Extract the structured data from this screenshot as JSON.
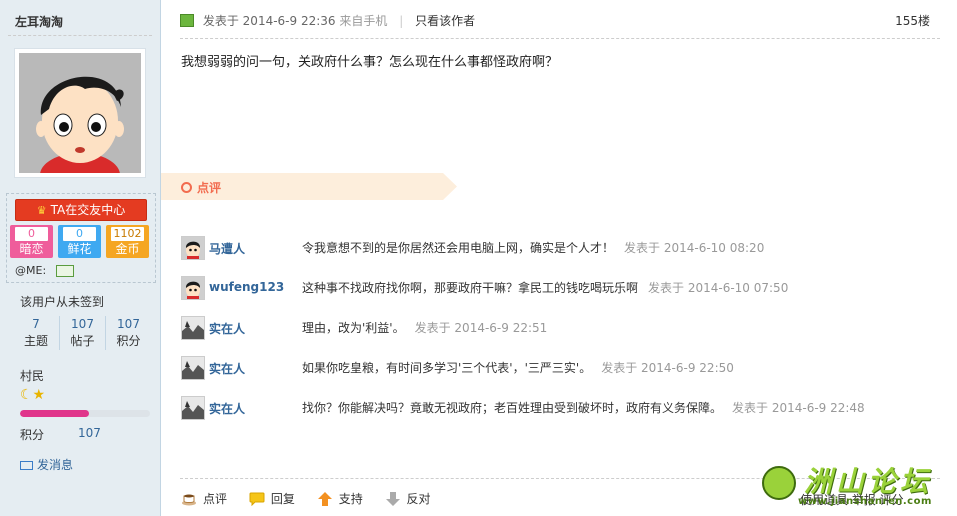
{
  "sidebar": {
    "username": "左耳淘淘",
    "ta_button": "TA在交友中心",
    "stats_buttons": [
      {
        "count": "0",
        "label": "暗恋",
        "color": "#ef5d9b"
      },
      {
        "count": "0",
        "label": "鲜花",
        "color": "#3fa9f1"
      },
      {
        "count": "1102",
        "label": "金币",
        "color": "#f5a623"
      }
    ],
    "me_label": "@ME:",
    "signin_status": "该用户从未签到",
    "counts": [
      {
        "value": "7",
        "label": "主题"
      },
      {
        "value": "107",
        "label": "帖子"
      },
      {
        "value": "107",
        "label": "积分"
      }
    ],
    "rank": "村民",
    "level_progress": 0.53,
    "points_label": "积分",
    "points_value": "107",
    "send_message": "发消息"
  },
  "post": {
    "posted_prefix": "发表于",
    "posted_time": "2014-6-9 22:36",
    "posted_via": "来自手机",
    "only_author": "只看该作者",
    "floor": "155楼",
    "content": "我想弱弱的问一句，关政府什么事？怎么现在什么事都怪政府啊？"
  },
  "review": {
    "title": "点评",
    "comments": [
      {
        "nick": "马遭人",
        "text": "令我意想不到的是你居然还会用电脑上网，确实是个人才！",
        "time": "发表于 2014-6-10 08:20"
      },
      {
        "nick": "wufeng123",
        "text": "这种事不找政府找你啊，那要政府干嘛？拿民工的钱吃喝玩乐啊",
        "time": "发表于 2014-6-10 07:50"
      },
      {
        "nick": "实在人",
        "text": "理由，改为'利益'。",
        "time": "发表于 2014-6-9 22:51"
      },
      {
        "nick": "实在人",
        "text": "如果你吃皇粮，有时间多学习'三个代表'，'三严三实'。",
        "time": "发表于 2014-6-9 22:50"
      },
      {
        "nick": "实在人",
        "text": "找你？你能解决吗？竟敢无视政府；老百姓理由受到破坏时，政府有义务保障。",
        "time": "发表于 2014-6-9 22:48"
      }
    ]
  },
  "actions": {
    "review": "点评",
    "reply": "回复",
    "support": "支持",
    "oppose": "反对",
    "partial": "使用道具 举报 评分"
  },
  "logo": {
    "text": "洲山论坛",
    "url": "www.jianshanren.com"
  }
}
